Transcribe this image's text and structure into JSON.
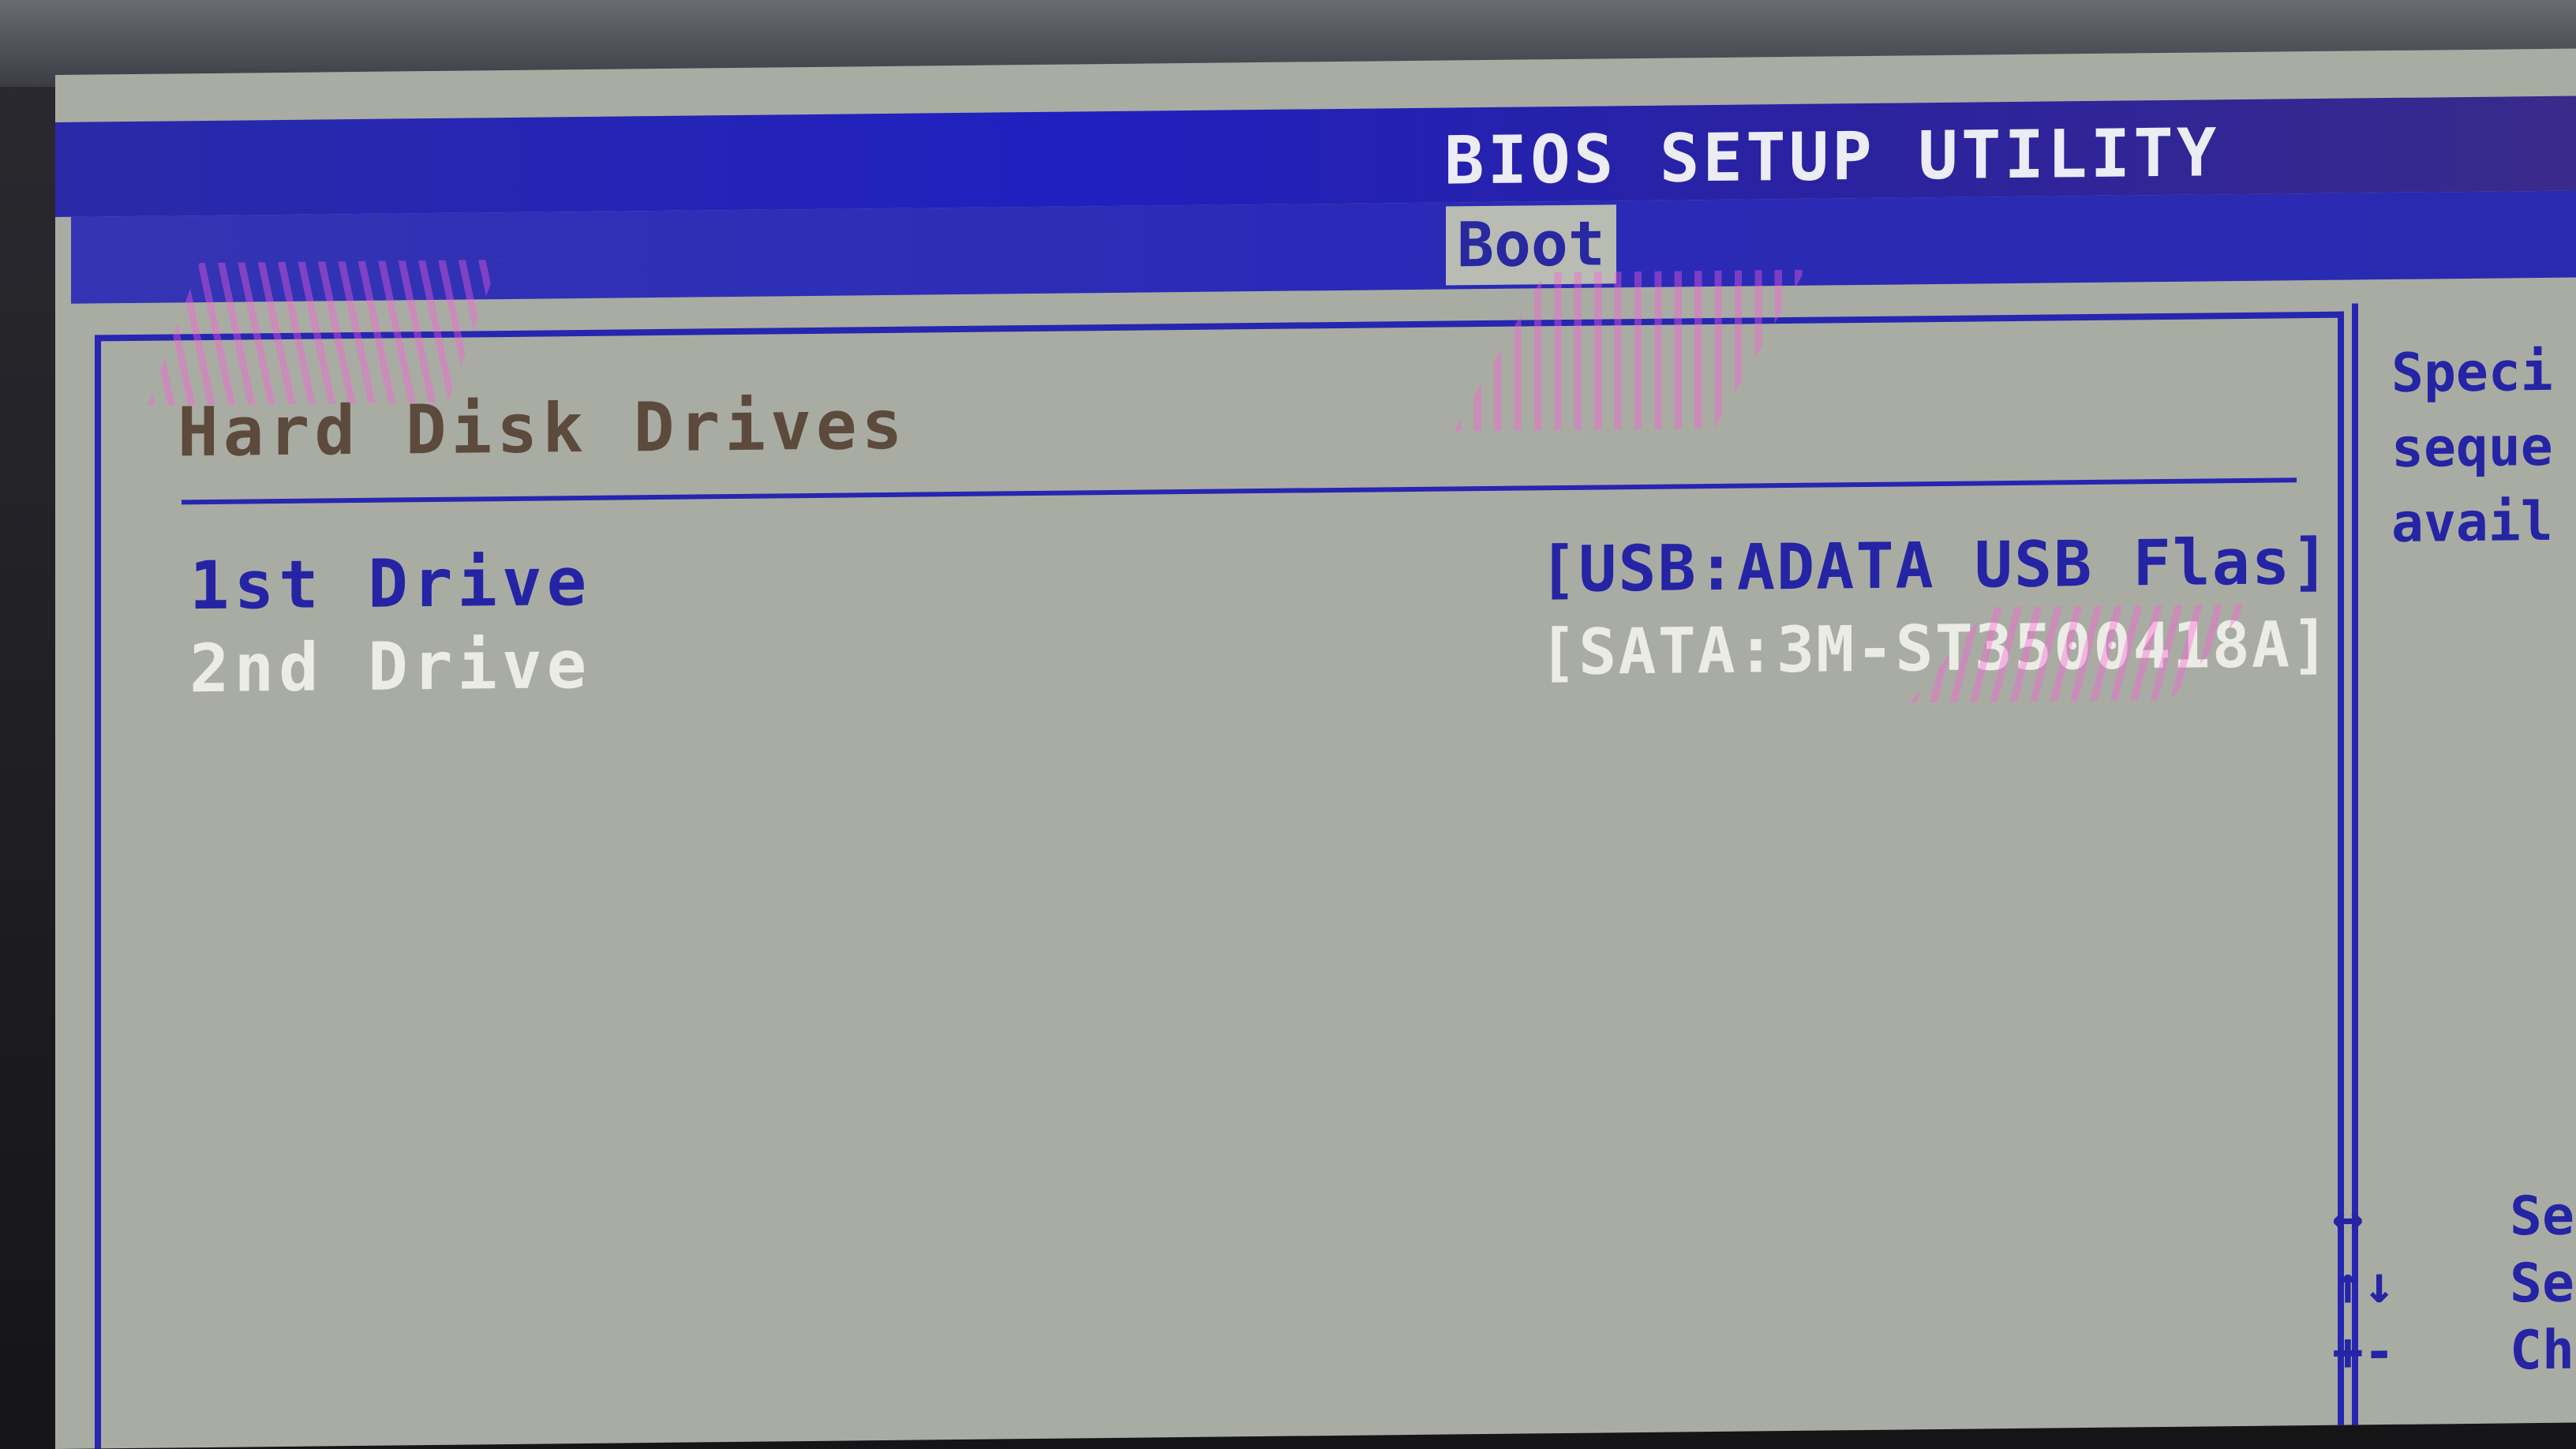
{
  "header": {
    "title": "BIOS SETUP UTILITY",
    "active_tab": "Boot"
  },
  "section": {
    "title": "Hard Disk Drives"
  },
  "drives": [
    {
      "label": "1st Drive",
      "value": "[USB:ADATA USB Flas]",
      "selected": true
    },
    {
      "label": "2nd Drive",
      "value": "[SATA:3M-ST3500418A]",
      "selected": false
    }
  ],
  "help": {
    "lines": [
      "Speci",
      "seque",
      "avail"
    ]
  },
  "keys": [
    {
      "symbol": "↔",
      "action": "Se"
    },
    {
      "symbol": "↑↓",
      "action": "Se"
    },
    {
      "symbol": "+-",
      "action": "Ch"
    }
  ],
  "colors": {
    "title_bar": "#2020c0",
    "panel_bg": "#a9aca3",
    "selected_text": "#2424a4",
    "unselected_text": "#ecece6",
    "section_title": "#5c4a3c"
  }
}
